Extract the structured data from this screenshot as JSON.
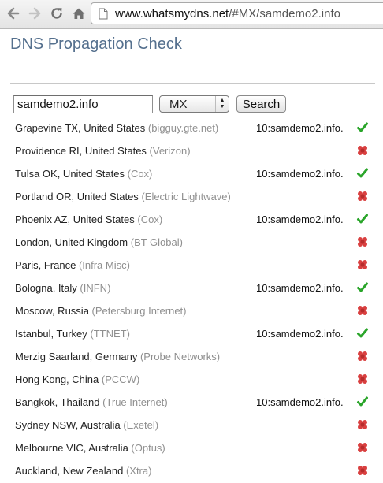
{
  "browser": {
    "url_host": "www.whatsmydns.net",
    "url_rest": "/#MX/samdemo2.info"
  },
  "page": {
    "title": "DNS Propagation Check"
  },
  "form": {
    "domain_value": "samdemo2.info",
    "record_type": "MX",
    "search_label": "Search"
  },
  "colors": {
    "title": "#55708e",
    "provider": "#8f8f8f",
    "ok": "#2aa52a",
    "fail": "#d94040"
  },
  "results": [
    {
      "location": "Grapevine TX, United States",
      "provider": "(bigguy.gte.net)",
      "record": "10:samdemo2.info.",
      "status": "ok"
    },
    {
      "location": "Providence RI, United States",
      "provider": "(Verizon)",
      "record": "",
      "status": "fail"
    },
    {
      "location": "Tulsa OK, United States",
      "provider": "(Cox)",
      "record": "10:samdemo2.info.",
      "status": "ok"
    },
    {
      "location": "Portland OR, United States",
      "provider": "(Electric Lightwave)",
      "record": "",
      "status": "fail"
    },
    {
      "location": "Phoenix AZ, United States",
      "provider": "(Cox)",
      "record": "10:samdemo2.info.",
      "status": "ok"
    },
    {
      "location": "London, United Kingdom",
      "provider": "(BT Global)",
      "record": "",
      "status": "fail"
    },
    {
      "location": "Paris, France",
      "provider": "(Infra Misc)",
      "record": "",
      "status": "fail"
    },
    {
      "location": "Bologna, Italy",
      "provider": "(INFN)",
      "record": "10:samdemo2.info.",
      "status": "ok"
    },
    {
      "location": "Moscow, Russia",
      "provider": "(Petersburg Internet)",
      "record": "",
      "status": "fail"
    },
    {
      "location": "Istanbul, Turkey",
      "provider": "(TTNET)",
      "record": "10:samdemo2.info.",
      "status": "ok"
    },
    {
      "location": "Merzig Saarland, Germany",
      "provider": "(Probe Networks)",
      "record": "",
      "status": "fail"
    },
    {
      "location": "Hong Kong, China",
      "provider": "(PCCW)",
      "record": "",
      "status": "fail"
    },
    {
      "location": "Bangkok, Thailand",
      "provider": "(True Internet)",
      "record": "10:samdemo2.info.",
      "status": "ok"
    },
    {
      "location": "Sydney NSW, Australia",
      "provider": "(Exetel)",
      "record": "",
      "status": "fail"
    },
    {
      "location": "Melbourne VIC, Australia",
      "provider": "(Optus)",
      "record": "",
      "status": "fail"
    },
    {
      "location": "Auckland, New Zealand",
      "provider": "(Xtra)",
      "record": "",
      "status": "fail"
    }
  ]
}
